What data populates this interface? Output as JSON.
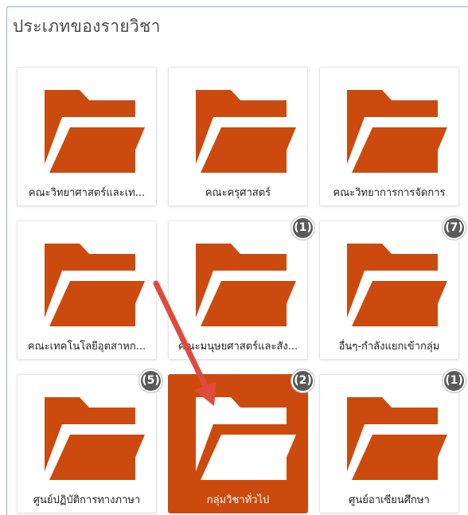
{
  "panel": {
    "title": "ประเภทของรายวิชา"
  },
  "colors": {
    "folder": "#cc4a0d",
    "active_tile": "#cc4a0d",
    "badge": "#5a5a5a",
    "arrow": "#e04a3c"
  },
  "icons": {
    "tile_icon": "folder-icon"
  },
  "categories": [
    {
      "label": "คณะวิทยาศาสตร์และเท...",
      "badge": "",
      "active": false
    },
    {
      "label": "คณะครุศาสตร์",
      "badge": "",
      "active": false
    },
    {
      "label": "คณะวิทยาการการจัดการ",
      "badge": "",
      "active": false
    },
    {
      "label": "คณะเทคโนโลยีอุตสาหก...",
      "badge": "",
      "active": false
    },
    {
      "label": "คณะมนุษยศาสตร์และสัง...",
      "badge": "(1)",
      "active": false
    },
    {
      "label": "อื่นๆ-กำลังแยกเข้ากลุ่ม",
      "badge": "(7)",
      "active": false
    },
    {
      "label": "ศูนย์ปฏิบัติการทางภาษา",
      "badge": "(5)",
      "active": false
    },
    {
      "label": "กลุ่มวิชาทั่วไป",
      "badge": "(2)",
      "active": true
    },
    {
      "label": "ศูนย์อาเซียนศึกษา",
      "badge": "(1)",
      "active": false
    }
  ]
}
